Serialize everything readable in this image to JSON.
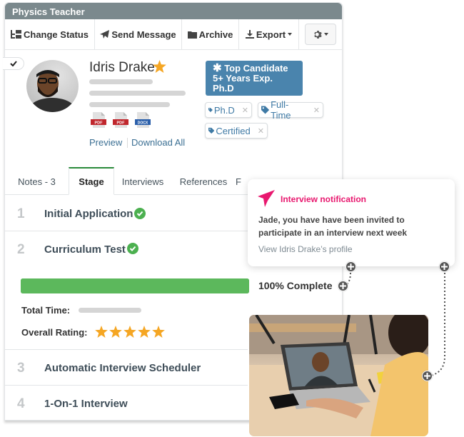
{
  "header": {
    "title": "Physics Teacher"
  },
  "toolbar": {
    "change_status": "Change Status",
    "send_message": "Send Message",
    "archive": "Archive",
    "export": "Export",
    "settings_icon": "gear-icon"
  },
  "candidate": {
    "name": "Idris Drake",
    "favorite": true,
    "files": [
      {
        "type": "PDF",
        "color": "#c0272d"
      },
      {
        "type": "PDF",
        "color": "#c0272d"
      },
      {
        "type": "DOCX",
        "color": "#2b5faa"
      }
    ],
    "preview_label": "Preview",
    "download_all_label": "Download All",
    "highlight_badge": {
      "line1": "Top Candidate",
      "line2": "5+ Years Exp.",
      "line3": "Ph.D",
      "color": "#4a84ad"
    },
    "tags": [
      "Ph.D",
      "Full-Time",
      "Certified"
    ]
  },
  "tabs": [
    {
      "label": "Notes - 3",
      "active": false
    },
    {
      "label": "Stage",
      "active": true
    },
    {
      "label": "Interviews",
      "active": false
    },
    {
      "label": "References",
      "active": false
    },
    {
      "label": "F",
      "active": false
    }
  ],
  "stages": [
    {
      "number": "1",
      "title": "Initial Application",
      "completed": true
    },
    {
      "number": "2",
      "title": "Curriculum Test",
      "completed": true
    },
    {
      "number": "3",
      "title": "Automatic Interview Scheduler",
      "completed": false
    },
    {
      "number": "4",
      "title": "1-On-1 Interview",
      "completed": false
    }
  ],
  "stage_detail": {
    "progress_percent": 100,
    "progress_label": "100% Complete",
    "total_time_label": "Total Time:",
    "overall_rating_label": "Overall Rating:",
    "rating": 5,
    "rating_max": 5,
    "progress_color": "#5cb85c",
    "star_color": "#f5a623"
  },
  "notification": {
    "title": "Interview notification",
    "body": "Jade, you have have been invited to participate in an interview next week",
    "link": "View Idris Drake’s profile",
    "accent_color": "#e8176e"
  }
}
